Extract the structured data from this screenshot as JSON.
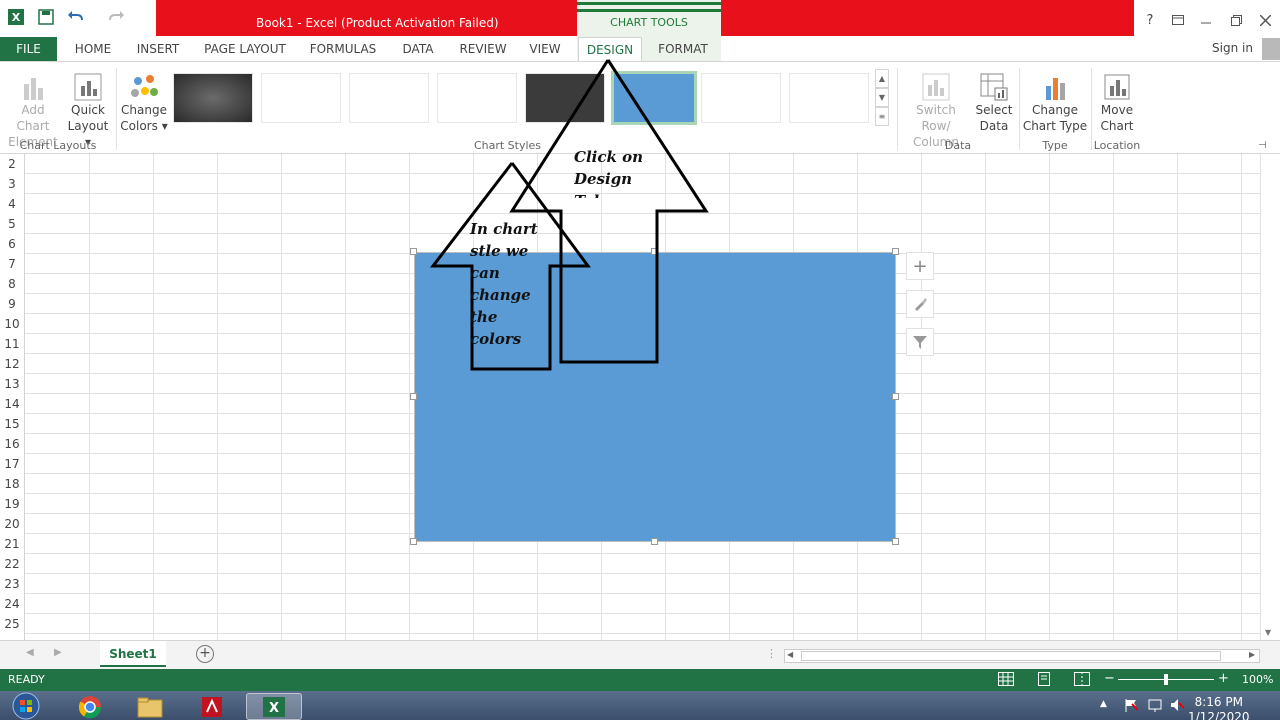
{
  "window": {
    "title": "Book1 -  Excel (Product Activation Failed)",
    "context_label": "CHART TOOLS",
    "help": "?"
  },
  "ribbon_tabs": {
    "file": "FILE",
    "items": [
      "HOME",
      "INSERT",
      "PAGE LAYOUT",
      "FORMULAS",
      "DATA",
      "REVIEW",
      "VIEW",
      "DESIGN",
      "FORMAT"
    ],
    "active": "DESIGN",
    "sign_in": "Sign in"
  },
  "ribbon": {
    "add_chart_element": [
      "Add Chart",
      "Element"
    ],
    "quick_layout": [
      "Quick",
      "Layout"
    ],
    "change_colors": [
      "Change",
      "Colors"
    ],
    "group_chart_layouts": "Chart Layouts",
    "group_chart_styles": "Chart Styles",
    "switch_row_column": [
      "Switch Row/",
      "Column"
    ],
    "select_data": [
      "Select",
      "Data"
    ],
    "group_data": "Data",
    "change_chart_type": [
      "Change",
      "Chart Type"
    ],
    "group_type": "Type",
    "move_chart": [
      "Move",
      "Chart"
    ],
    "group_location": "Location"
  },
  "grid": {
    "rows": [
      "2",
      "3",
      "4",
      "5",
      "6",
      "7",
      "8",
      "9",
      "10",
      "11",
      "12",
      "13",
      "14",
      "15",
      "16",
      "17",
      "18",
      "19",
      "20",
      "21",
      "22",
      "23",
      "24",
      "25"
    ]
  },
  "annotations": {
    "design_note": [
      "Click on",
      "Design",
      "Tab"
    ],
    "styles_note": [
      "In chart",
      "stle we",
      "can",
      "change",
      "the colors"
    ]
  },
  "sheets": {
    "active": "Sheet1"
  },
  "status": {
    "mode": "READY",
    "zoom": "100%"
  },
  "taskbar": {
    "time": "8:16 PM",
    "date": "1/12/2020"
  },
  "colors": {
    "excel_green": "#217346",
    "title_red": "#e8101a",
    "chart_fill": "#5b9bd5"
  }
}
